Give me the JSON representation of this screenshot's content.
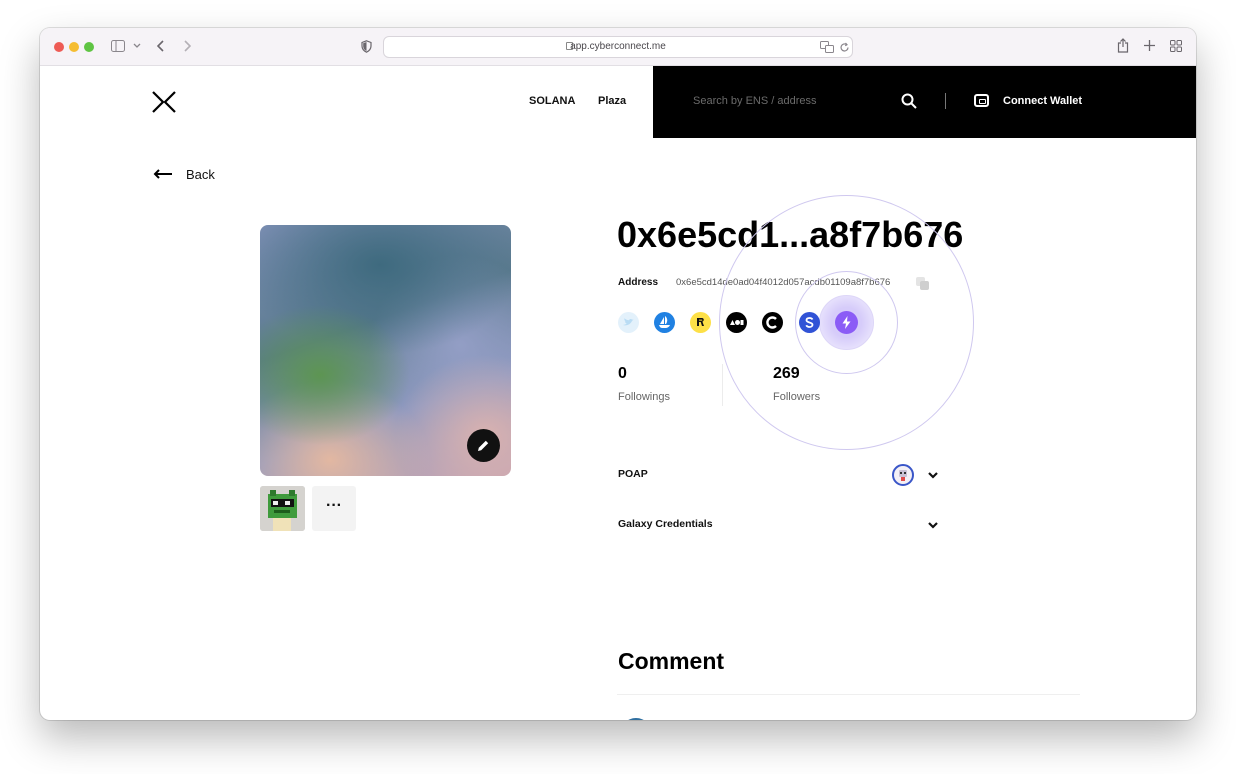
{
  "browser": {
    "url": "app.cyberconnect.me",
    "icons": [
      "sidebar-icon",
      "chevron-down-icon",
      "back-icon",
      "forward-icon",
      "shield-icon",
      "translate-icon",
      "reload-icon",
      "share-icon",
      "plus-icon",
      "tab-overview-icon"
    ]
  },
  "header": {
    "nav": [
      "SOLANA",
      "Plaza"
    ],
    "search_placeholder": "Search by ENS / address",
    "connect_label": "Connect Wallet"
  },
  "page": {
    "back_label": "Back",
    "more_label": "···",
    "wallet_title": "0x6e5cd1...a8f7b676",
    "address_label": "Address",
    "address_value": "0x6e5cd14de0ad04f4012d057acdb01109a8f7b676",
    "socials": [
      "twitter-icon",
      "opensea-icon",
      "rarible-icon",
      "foundation-icon",
      "cyberconnect-icon",
      "superrare-icon",
      "zora-lightning-icon"
    ],
    "stats": {
      "followings": {
        "value": "0",
        "label": "Followings"
      },
      "followers": {
        "value": "269",
        "label": "Followers"
      }
    },
    "sections": [
      {
        "label": "POAP"
      },
      {
        "label": "Galaxy Credentials"
      }
    ],
    "comment_title": "Comment"
  },
  "colors": {
    "accent_purple": "#8b5cf6",
    "header_black": "#000000",
    "ring": "#cfc8ef"
  }
}
